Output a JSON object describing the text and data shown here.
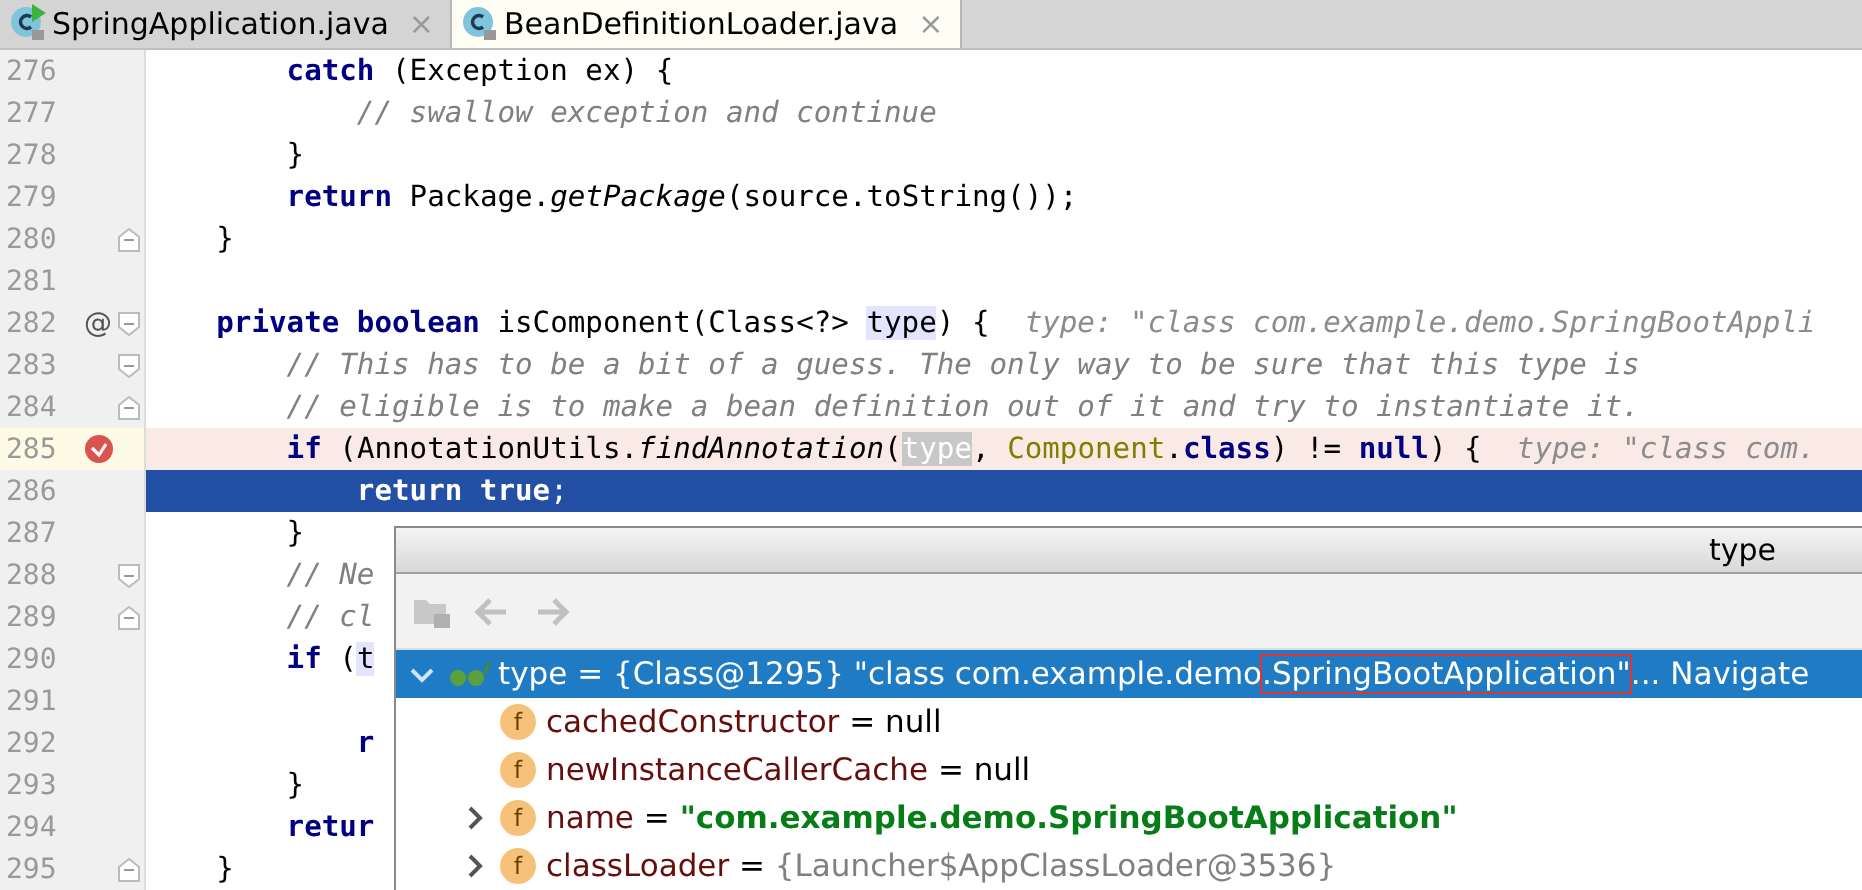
{
  "tabs": [
    {
      "label": "SpringApplication.java",
      "close": "×",
      "selected": false,
      "runnable": true
    },
    {
      "label": "BeanDefinitionLoader.java",
      "close": "×",
      "selected": true,
      "runnable": false
    }
  ],
  "editor": {
    "lines": [
      {
        "number": "276",
        "kind": "normal",
        "segments": [
          {
            "kind": "keyword",
            "text": "        catch"
          },
          {
            "kind": "plain",
            "text": " (Exception ex) {"
          }
        ]
      },
      {
        "number": "277",
        "kind": "normal",
        "segments": [
          {
            "kind": "comment",
            "text": "            // swallow exception and continue"
          }
        ]
      },
      {
        "number": "278",
        "kind": "normal",
        "segments": [
          {
            "kind": "plain",
            "text": "        }"
          }
        ]
      },
      {
        "number": "279",
        "kind": "normal",
        "segments": [
          {
            "kind": "keyword",
            "text": "        return"
          },
          {
            "kind": "plain",
            "text": " Package."
          },
          {
            "kind": "method",
            "text": "getPackage"
          },
          {
            "kind": "plain",
            "text": "(source.toString());"
          }
        ]
      },
      {
        "number": "280",
        "kind": "normal",
        "fold_end": true,
        "segments": [
          {
            "kind": "plain",
            "text": "    }"
          }
        ]
      },
      {
        "number": "281",
        "kind": "normal"
      },
      {
        "number": "282",
        "kind": "normal",
        "marker": "@",
        "fold_start": true,
        "segments": [
          {
            "kind": "keyword",
            "text": "    private boolean"
          },
          {
            "kind": "plain",
            "text": " isComponent(Class<?> "
          },
          {
            "kind": "usage",
            "text": "type"
          },
          {
            "kind": "plain",
            "text": ") {"
          },
          {
            "kind": "hint",
            "text": "  type: \"class com.example.demo.SpringBootAppli"
          }
        ]
      },
      {
        "number": "283",
        "kind": "normal",
        "fold_start": true,
        "segments": [
          {
            "kind": "comment",
            "text": "        // This has to be a bit of a guess. The only way to be sure that this type is"
          }
        ]
      },
      {
        "number": "284",
        "kind": "normal",
        "fold_end": true,
        "segments": [
          {
            "kind": "comment",
            "text": "        // eligible is to make a bean definition out of it and try to instantiate it."
          }
        ]
      },
      {
        "number": "285",
        "kind": "breakpoint",
        "segments": [
          {
            "kind": "keyword",
            "text": "        if"
          },
          {
            "kind": "plain",
            "text": " (AnnotationUtils."
          },
          {
            "kind": "method",
            "text": "findAnnotation"
          },
          {
            "kind": "plain",
            "text": "("
          },
          {
            "kind": "selection",
            "text": "type"
          },
          {
            "kind": "plain",
            "text": ", "
          },
          {
            "kind": "class",
            "text": "Component"
          },
          {
            "kind": "plain",
            "text": "."
          },
          {
            "kind": "keyword",
            "text": "class"
          },
          {
            "kind": "plain",
            "text": ") != "
          },
          {
            "kind": "keyword",
            "text": "null"
          },
          {
            "kind": "plain",
            "text": ") {"
          },
          {
            "kind": "hint",
            "text": "  type: \"class com."
          }
        ]
      },
      {
        "number": "286",
        "kind": "execution",
        "segments": [
          {
            "kind": "keyword",
            "text": "            return true"
          },
          {
            "kind": "plain",
            "text": ";"
          }
        ]
      },
      {
        "number": "287",
        "kind": "normal",
        "segments": [
          {
            "kind": "plain",
            "text": "        }"
          }
        ]
      },
      {
        "number": "288",
        "kind": "normal",
        "fold_start": true,
        "segments": [
          {
            "kind": "comment",
            "text": "        // Ne"
          }
        ]
      },
      {
        "number": "289",
        "kind": "normal",
        "fold_end": true,
        "segments": [
          {
            "kind": "comment",
            "text": "        // cl"
          }
        ]
      },
      {
        "number": "290",
        "kind": "normal",
        "segments": [
          {
            "kind": "keyword",
            "text": "        if"
          },
          {
            "kind": "plain",
            "text": " ("
          },
          {
            "kind": "usage",
            "text": "t"
          }
        ]
      },
      {
        "number": "291",
        "kind": "normal"
      },
      {
        "number": "292",
        "kind": "normal",
        "segments": [
          {
            "kind": "keyword",
            "text": "            r"
          }
        ]
      },
      {
        "number": "293",
        "kind": "normal",
        "segments": [
          {
            "kind": "plain",
            "text": "        }"
          }
        ]
      },
      {
        "number": "294",
        "kind": "normal",
        "segments": [
          {
            "kind": "keyword",
            "text": "        retur"
          }
        ]
      },
      {
        "number": "295",
        "kind": "normal",
        "fold_end": true,
        "segments": [
          {
            "kind": "plain",
            "text": "    }"
          }
        ]
      }
    ]
  },
  "popup": {
    "title": "type",
    "tree": [
      {
        "kind": "watch",
        "name": "type",
        "value": [
          {
            "text": " = {Class@1295} \"class com.example.demo",
            "boxed": false
          },
          {
            "text": ".SpringBootApplication\"",
            "boxed": true
          }
        ],
        "link": "... Navigate",
        "selected": true,
        "expanded": true,
        "children": [
          {
            "kind": "field",
            "icon_letter": "f",
            "name": "cachedConstructor",
            "value": [
              {
                "kind": "plain",
                "text": " = null",
                "boxed": false
              }
            ],
            "selected": false
          },
          {
            "kind": "field",
            "icon_letter": "f",
            "name": "newInstanceCallerCache",
            "value": [
              {
                "kind": "plain",
                "text": " = null",
                "boxed": false
              }
            ],
            "selected": false
          },
          {
            "kind": "field",
            "icon_letter": "f",
            "name": "name",
            "value": [
              {
                "kind": "plain",
                "text": " = ",
                "boxed": false
              },
              {
                "kind": "string",
                "text": "\"com.example.demo.SpringBootApplication\"",
                "boxed": false
              }
            ],
            "selected": false,
            "expanded": false
          },
          {
            "kind": "field",
            "icon_letter": "f",
            "name": "classLoader",
            "value": [
              {
                "kind": "plain",
                "text": " = ",
                "boxed": false
              },
              {
                "kind": "object",
                "text": "{Launcher$AppClassLoader@3536}",
                "boxed": false
              }
            ],
            "selected": false,
            "expanded": false
          }
        ]
      }
    ]
  }
}
